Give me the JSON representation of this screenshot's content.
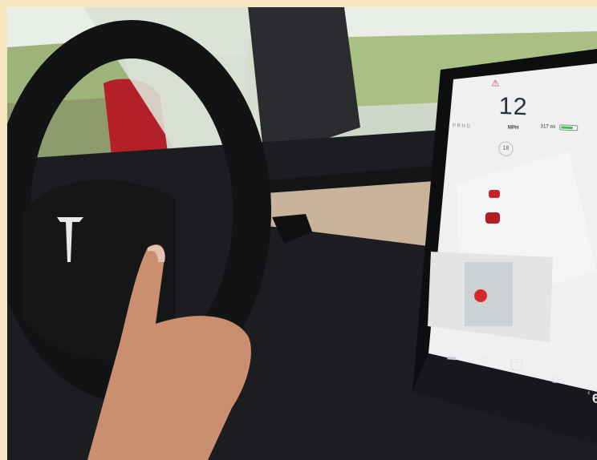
{
  "photo": {
    "subject": "Tesla interior",
    "colors": {
      "frame": "#f6e6c2",
      "screen_bg": "#eef0f2",
      "wheel": "#121314",
      "dash_wood": "#c9b39a",
      "accent_red": "#d42a2a",
      "battery_green": "#39c24e"
    }
  },
  "screen": {
    "speed": "12",
    "speed_unit": "MPH",
    "gear": "P R N D",
    "range": "317 mi",
    "battery_level": 0.8,
    "speed_limit": "18",
    "icons": {
      "seatbelt": "seatbelt-warning-icon",
      "lock": "lock-icon",
      "car": "car-icon",
      "music": "music-note-icon",
      "apps": "chevron-up-icon",
      "phone": "phone-icon",
      "back": "chevron-left-icon"
    },
    "glyphs": {
      "seatbelt": "⚠",
      "car": "▬",
      "music": "♫",
      "apps": "⌃",
      "phone": "✆",
      "back": "‹"
    },
    "dock_number": "6"
  }
}
